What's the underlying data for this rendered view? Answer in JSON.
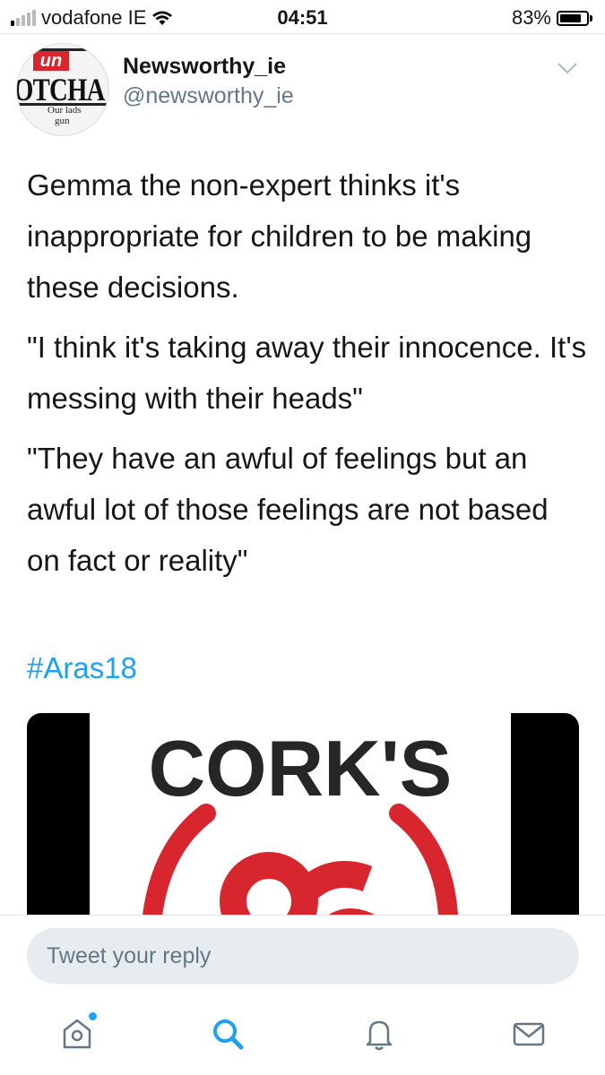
{
  "status_bar": {
    "carrier": "vodafone IE",
    "time": "04:51",
    "battery": "83%",
    "battery_level": 0.83
  },
  "tweet": {
    "display_name": "Newsworthy_ie",
    "handle": "@newsworthy_ie",
    "avatar_text": {
      "top": "un",
      "middle": "OTCHA",
      "bottom_1": "Our lads",
      "bottom_2": "gun"
    },
    "paragraphs": [
      "Gemma the non-expert thinks it's inappropriate for children to be making these decisions.",
      "\"I think it's taking away their innocence. It's messing with their heads\"",
      "\"They have an awful of feelings but an awful lot of those feelings are not based on fact or reality\""
    ],
    "hashtag": "#Aras18",
    "media_text": "CORK'S"
  },
  "reply": {
    "placeholder": "Tweet your reply"
  },
  "colors": {
    "accent": "#1da1f2",
    "text": "#14171a",
    "secondary": "#657786",
    "input_bg": "#e6ecf0",
    "logo_red": "#d8262f"
  },
  "tabbar": {
    "items": [
      {
        "name": "home",
        "icon": "home-icon",
        "active": false,
        "has_notification_dot": true
      },
      {
        "name": "search",
        "icon": "search-icon",
        "active": true
      },
      {
        "name": "notifications",
        "icon": "bell-icon",
        "active": false
      },
      {
        "name": "messages",
        "icon": "envelope-icon",
        "active": false
      }
    ]
  }
}
